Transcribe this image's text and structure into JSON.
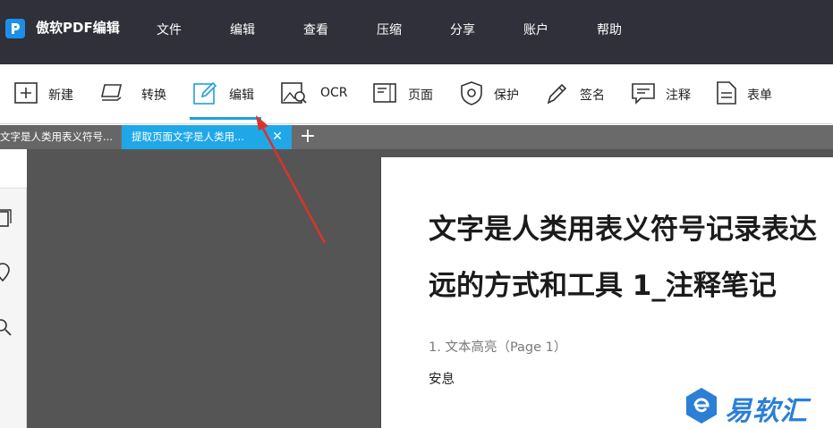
{
  "app": {
    "title": "傲软PDF编辑"
  },
  "menu": {
    "items": [
      "文件",
      "编辑",
      "查看",
      "压缩",
      "分享",
      "账户",
      "帮助"
    ]
  },
  "toolbar": {
    "items": [
      {
        "label": "新建",
        "icon": "plus-box-icon"
      },
      {
        "label": "转换",
        "icon": "convert-icon"
      },
      {
        "label": "编辑",
        "icon": "edit-pencil-icon"
      },
      {
        "label": "OCR",
        "icon": "ocr-image-search-icon"
      },
      {
        "label": "页面",
        "icon": "page-icon"
      },
      {
        "label": "保护",
        "icon": "shield-icon"
      },
      {
        "label": "签名",
        "icon": "pen-icon"
      },
      {
        "label": "注释",
        "icon": "comment-icon"
      },
      {
        "label": "表单",
        "icon": "form-document-icon"
      }
    ],
    "active": "编辑"
  },
  "tabs": {
    "items": [
      {
        "label": "文字是人类用表义符号..."
      },
      {
        "label": "提取页面文字是人类用..."
      }
    ],
    "active_index": 1
  },
  "sidebar": {
    "icons": [
      "pages-icon",
      "comment-pin-icon",
      "search-icon"
    ]
  },
  "document": {
    "title_line1": "文字是人类用表义符号记录表达",
    "title_line2": "远的方式和工具 1_注释笔记",
    "note": "1. 文本高亮（Page 1）",
    "body": "安息"
  },
  "watermark": {
    "text": "易软汇"
  },
  "colors": {
    "menubar": "#2f3039",
    "accent": "#1fa8e8",
    "arrow": "#d9342b",
    "watermark": "#2b7fd6"
  }
}
